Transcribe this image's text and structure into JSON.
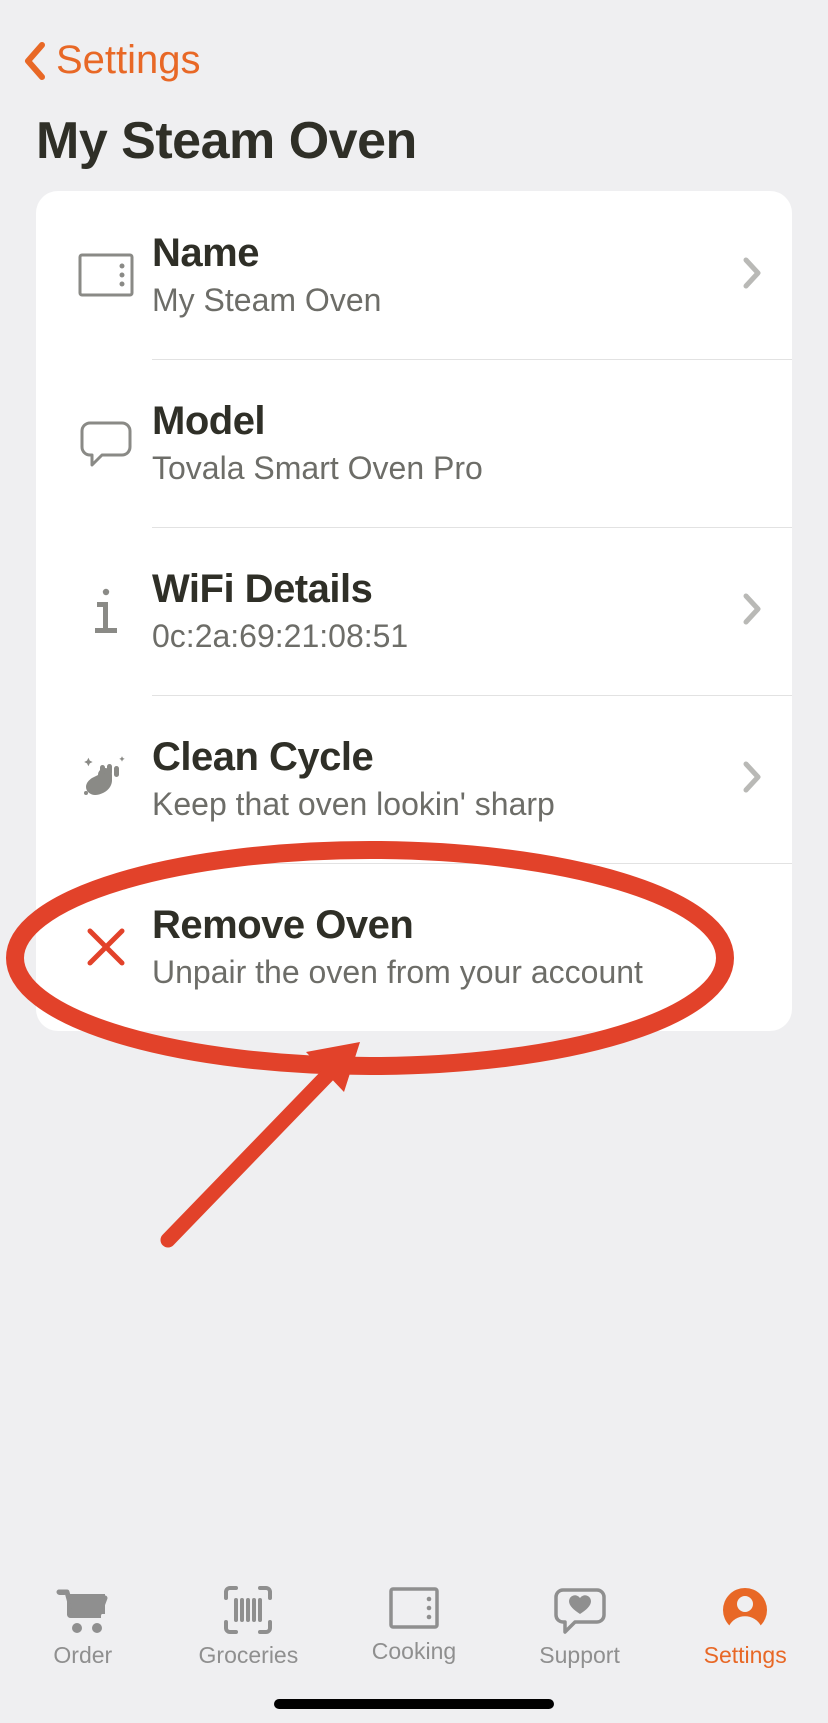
{
  "nav": {
    "back_label": "Settings"
  },
  "page": {
    "title": "My Steam Oven"
  },
  "rows": {
    "name": {
      "label": "Name",
      "value": "My Steam Oven"
    },
    "model": {
      "label": "Model",
      "value": "Tovala Smart Oven Pro"
    },
    "wifi": {
      "label": "WiFi Details",
      "value": "0c:2a:69:21:08:51"
    },
    "clean": {
      "label": "Clean Cycle",
      "value": "Keep that oven lookin' sharp"
    },
    "remove": {
      "label": "Remove Oven",
      "value": "Unpair the oven from your account"
    }
  },
  "tabs": {
    "order": "Order",
    "groceries": "Groceries",
    "cooking": "Cooking",
    "support": "Support",
    "settings": "Settings"
  },
  "annotation": {
    "color": "#e2422a",
    "target": "remove-oven-row"
  }
}
